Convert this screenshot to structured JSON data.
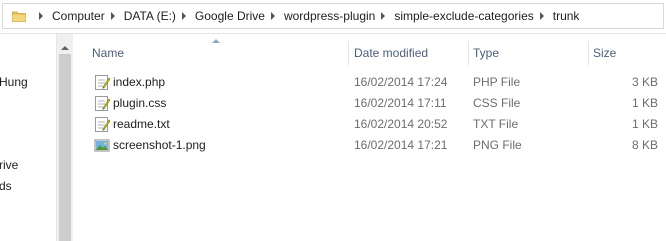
{
  "address_bar": {
    "folder_icon": "folder-icon",
    "breadcrumbs": [
      "Computer",
      "DATA (E:)",
      "Google Drive",
      "wordpress-plugin",
      "simple-exclude-categories",
      "trunk"
    ]
  },
  "nav_pane": {
    "items": [
      "Hung",
      "rive",
      "ds"
    ]
  },
  "columns": {
    "name": "Name",
    "date_modified": "Date modified",
    "type": "Type",
    "size": "Size"
  },
  "files": [
    {
      "name": "index.php",
      "date": "16/02/2014 17:24",
      "type": "PHP File",
      "size": "3 KB",
      "icon": "notepad-document-icon"
    },
    {
      "name": "plugin.css",
      "date": "16/02/2014 17:11",
      "type": "CSS File",
      "size": "1 KB",
      "icon": "notepad-document-icon"
    },
    {
      "name": "readme.txt",
      "date": "16/02/2014 20:52",
      "type": "TXT File",
      "size": "1 KB",
      "icon": "notepad-document-icon"
    },
    {
      "name": "screenshot-1.png",
      "date": "16/02/2014 17:21",
      "type": "PNG File",
      "size": "8 KB",
      "icon": "image-file-icon"
    }
  ],
  "colors": {
    "header_text": "#4c607a",
    "detail_text": "#6d6d6d",
    "folder": "#e8c25a"
  }
}
